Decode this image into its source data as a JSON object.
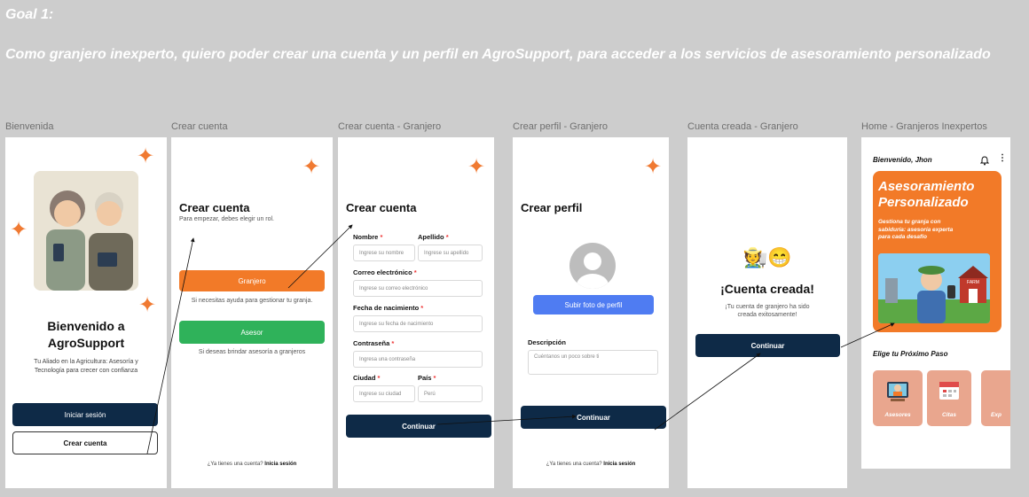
{
  "goal": {
    "title": "Goal 1:",
    "text": "Como granjero inexperto, quiero poder crear una cuenta y un perfil en AgroSupport, para acceder a los servicios de asesoramiento personalizado"
  },
  "frames": [
    {
      "label": "Bienvenida"
    },
    {
      "label": "Crear cuenta"
    },
    {
      "label": "Crear cuenta - Granjero"
    },
    {
      "label": "Crear perfil - Granjero"
    },
    {
      "label": "Cuenta creada - Granjero"
    },
    {
      "label": "Home - Granjeros Inexpertos"
    }
  ],
  "welcome": {
    "title_line1": "Bienvenido a",
    "title_line2": "AgroSupport",
    "subtitle_line1": "Tu Aliado en la Agricultura: Asesoría y",
    "subtitle_line2": "Tecnología para crecer con confianza",
    "login_button": "Iniciar sesión",
    "create_button": "Crear cuenta"
  },
  "role": {
    "title": "Crear cuenta",
    "subtitle": "Para empezar, debes elegir un rol.",
    "farmer_button": "Granjero",
    "farmer_hint": "Si necesitas ayuda para gestionar tu granja.",
    "advisor_button": "Asesor",
    "advisor_hint": "Si deseas brindar asesoría a granjeros",
    "footer_text": "¿Ya tienes una cuenta?",
    "footer_link": "Inicia sesión"
  },
  "register": {
    "title": "Crear cuenta",
    "name_label": "Nombre",
    "name_placeholder": "Ingrese su nombre",
    "lastname_label": "Apellido",
    "lastname_placeholder": "Ingrese su apellido",
    "email_label": "Correo electrónico",
    "email_placeholder": "Ingrese su correo electrónico",
    "birth_label": "Fecha de nacimiento",
    "birth_placeholder": "Ingrese su fecha de nacimiento",
    "password_label": "Contraseña",
    "password_placeholder": "Ingresa una contraseña",
    "city_label": "Ciudad",
    "city_placeholder": "Ingrese su ciudad",
    "country_label": "País",
    "country_placeholder": "Perú",
    "required_mark": "*",
    "continue_button": "Continuar"
  },
  "profile": {
    "title": "Crear perfil",
    "upload_button": "Subir foto de perfil",
    "description_label": "Descripción",
    "description_placeholder": "Cuéntanos un poco sobre ti",
    "continue_button": "Continuar",
    "footer_text": "¿Ya tienes una cuenta?",
    "footer_link": "Inicia sesión"
  },
  "created": {
    "emoji": "🧑‍🌾😁",
    "title": "¡Cuenta creada!",
    "text_line1": "¡Tu cuenta de granjero ha sido",
    "text_line2": "creada exitosamente!",
    "continue_button": "Continuar"
  },
  "home": {
    "greeting": "Bienvenido, Jhon",
    "banner_title_line1": "Asesoramiento",
    "banner_title_line2": "Personalizado",
    "banner_text_line1": "Gestiona tu granja con",
    "banner_text_line2": "sabiduría: asesoría experta",
    "banner_text_line3": "para cada desafío",
    "barn_sign": "FARM",
    "section_title": "Elige tu Próximo Paso",
    "cards": [
      {
        "label": "Asesores"
      },
      {
        "label": "Citas"
      },
      {
        "label": "Exp"
      }
    ]
  },
  "colors": {
    "accent": "#f27a28",
    "dark": "#0e2a47",
    "green": "#2fb25a",
    "blue": "#4f7cf2"
  }
}
